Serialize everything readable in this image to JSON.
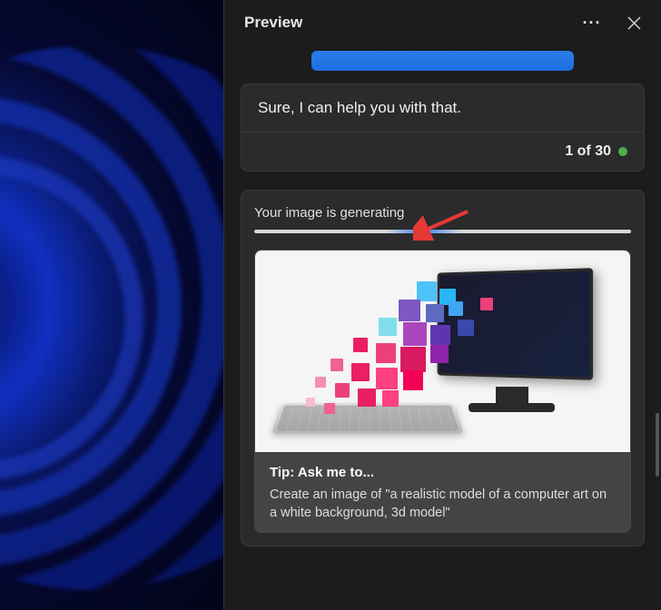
{
  "header": {
    "title": "Preview"
  },
  "response": {
    "text": "Sure, I can help you with that.",
    "counter": "1 of 30"
  },
  "generating": {
    "label": "Your image is generating"
  },
  "tip": {
    "title": "Tip: Ask me to...",
    "text": "Create an image of \"a realistic model of a computer art on a white background, 3d model\""
  }
}
